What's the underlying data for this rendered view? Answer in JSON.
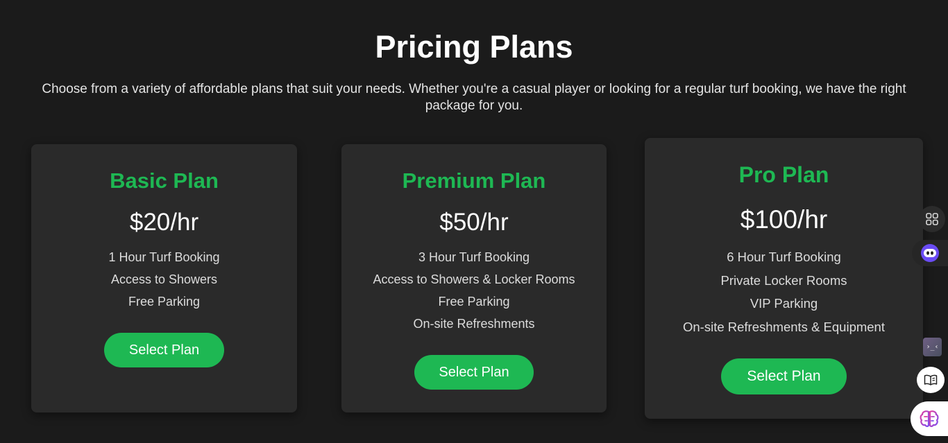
{
  "header": {
    "title": "Pricing Plans",
    "subtitle": "Choose from a variety of affordable plans that suit your needs. Whether you're a casual player or looking for a regular turf booking, we have the right package for you."
  },
  "plans": [
    {
      "name": "Basic Plan",
      "price": "$20/hr",
      "features": [
        "1 Hour Turf Booking",
        "Access to Showers",
        "Free Parking"
      ],
      "button_label": "Select Plan"
    },
    {
      "name": "Premium Plan",
      "price": "$50/hr",
      "features": [
        "3 Hour Turf Booking",
        "Access to Showers & Locker Rooms",
        "Free Parking",
        "On-site Refreshments"
      ],
      "button_label": "Select Plan"
    },
    {
      "name": "Pro Plan",
      "price": "$100/hr",
      "features": [
        "6 Hour Turf Booking",
        "Private Locker Rooms",
        "VIP Parking",
        "On-site Refreshments & Equipment"
      ],
      "button_label": "Select Plan"
    }
  ],
  "side_widgets": {
    "code_glyph": "›_‹",
    "icons": [
      "apps-grid-icon",
      "assistant-bot-icon",
      "code-tool-icon",
      "reader-book-icon",
      "ai-brain-icon"
    ]
  },
  "colors": {
    "background": "#1b1b1b",
    "card": "#2a2a2a",
    "accent": "#1eb853"
  }
}
